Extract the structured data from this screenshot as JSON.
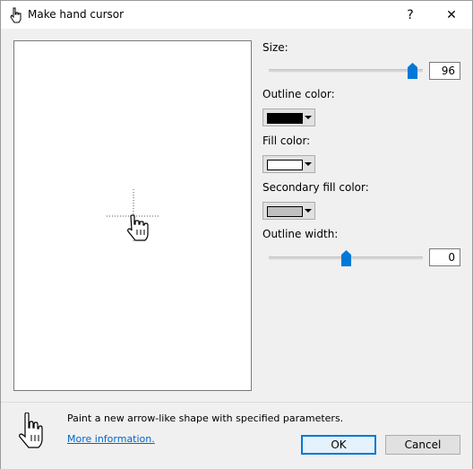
{
  "window": {
    "title": "Make hand cursor",
    "help_label": "?",
    "close_label": "✕"
  },
  "size": {
    "label": "Size:",
    "value": "96",
    "slider_fraction": 0.95
  },
  "outline_color": {
    "label": "Outline color:",
    "color": "#000000"
  },
  "fill_color": {
    "label": "Fill color:",
    "color": "#ffffff"
  },
  "secondary_fill_color": {
    "label": "Secondary fill color:",
    "color": "#c0c0c0"
  },
  "outline_width": {
    "label": "Outline width:",
    "value": "0",
    "slider_fraction": 0.5
  },
  "info": {
    "description": "Paint a new arrow-like shape with specified parameters.",
    "more_link": "More information."
  },
  "buttons": {
    "ok": "OK",
    "cancel": "Cancel"
  },
  "accent": "#0078d7"
}
